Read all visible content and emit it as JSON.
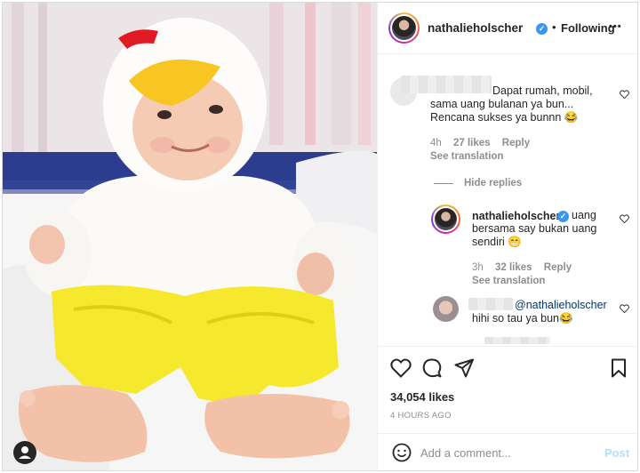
{
  "post": {
    "author": "nathalieholscher",
    "separator": "•",
    "follow_status": "Following",
    "more": "•••"
  },
  "comments": [
    {
      "id": "c1",
      "text_lines": [
        "Dapat rumah, mobil,",
        "sama uang bulanan ya bun...",
        "Rencana sukses ya bunnn 😂"
      ],
      "time": "4h",
      "likes": "27 likes",
      "reply": "Reply",
      "see_translation": "See translation",
      "hide_replies": "Hide replies"
    },
    {
      "id": "c2",
      "author": "nathalieholscher",
      "text_lines": [
        "uang",
        "bersama say bukan uang",
        "sendiri 😁"
      ],
      "time": "3h",
      "likes": "32 likes",
      "reply": "Reply",
      "see_translation": "See translation"
    },
    {
      "id": "c3",
      "mention": "@nathalieholscher",
      "text": "hihi so tau ya bun😂"
    }
  ],
  "stats": {
    "likes": "34,054 likes",
    "time_ago": "4 HOURS AGO"
  },
  "add_comment": {
    "placeholder": "Add a comment...",
    "post_label": "Post"
  },
  "colors": {
    "accent": "#3897f0",
    "post_disabled": "#b2dffc",
    "muted": "#8e8e8e",
    "text": "#262626"
  },
  "icons": [
    "user-tag-icon",
    "verified-icon",
    "more-icon",
    "heart-icon",
    "comment-icon",
    "share-icon",
    "bookmark-icon",
    "emoji-icon"
  ]
}
